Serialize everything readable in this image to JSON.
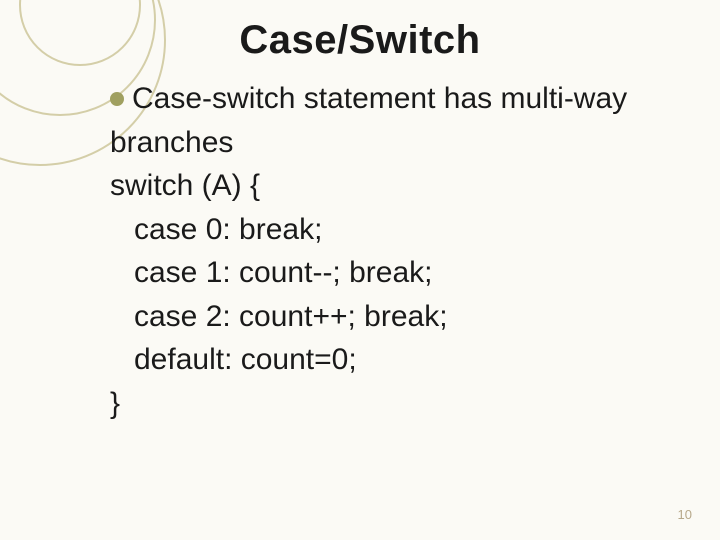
{
  "title": "Case/Switch",
  "bullet": "Case-switch statement has multi-way",
  "bullet_wrap": "branches",
  "lines": {
    "l0": "switch (A) {",
    "l1": "case 0:  break;",
    "l2": "case 1:  count--; break;",
    "l3": "case 2:  count++; break;",
    "l4": "default: count=0;",
    "l5": "}"
  },
  "page_number": "10",
  "colors": {
    "bullet": "#a0a060",
    "decor_stroke": "#cfc9a9",
    "background": "#fbfaf5"
  }
}
